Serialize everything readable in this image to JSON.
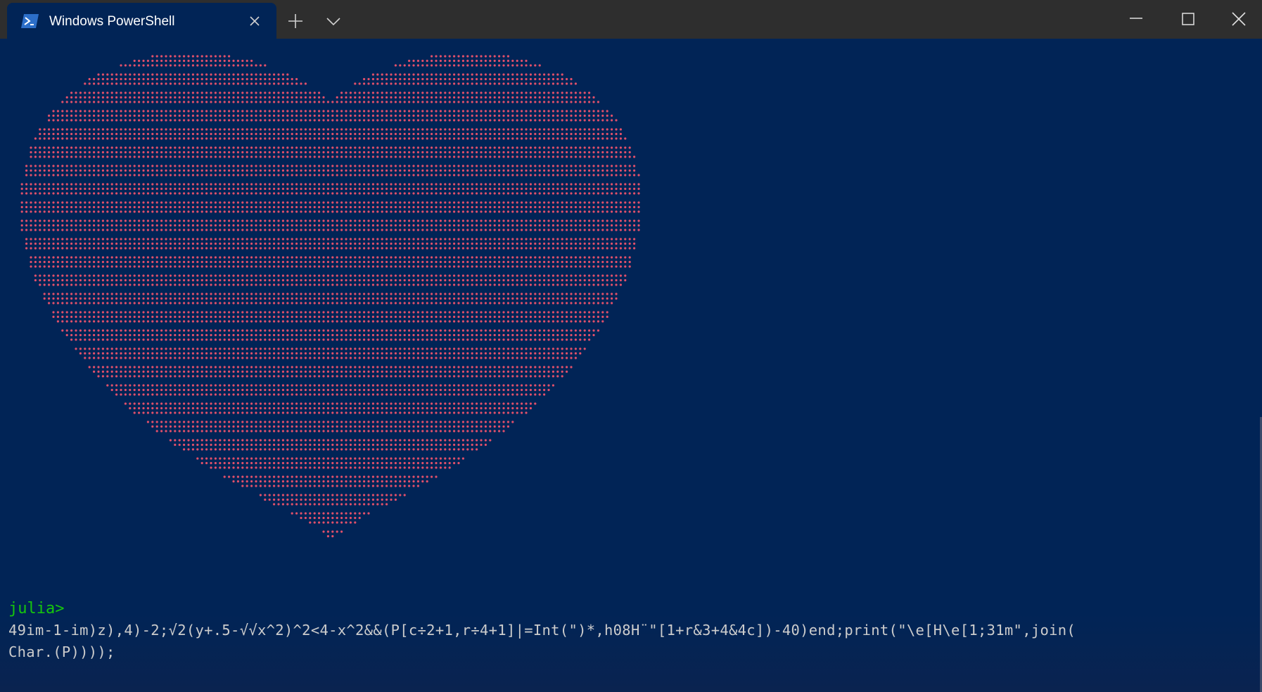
{
  "window": {
    "tab_title": "Windows PowerShell",
    "tab_icon": "powershell-icon",
    "new_tab_icon": "plus-icon",
    "dropdown_icon": "chevron-down-icon",
    "minimize_icon": "minimize-icon",
    "maximize_icon": "maximize-icon",
    "close_icon": "close-icon"
  },
  "terminal": {
    "prompt": "julia>",
    "command_line_1": "49im-1-im)z),4)-2;√2(y+.5-√√x^2)^2<4-x^2&&(P[c÷2+1,r÷4+1]|=Int(\")*,h08H¨\"[1+r&3+4&4c])-40)end;print(\"\\e[H\\e[1;31m\",join(",
    "command_line_2": "Char.(P))));",
    "heart_color": "#e0506a",
    "prompt_color": "#16c60c",
    "background_color": "#012456"
  }
}
